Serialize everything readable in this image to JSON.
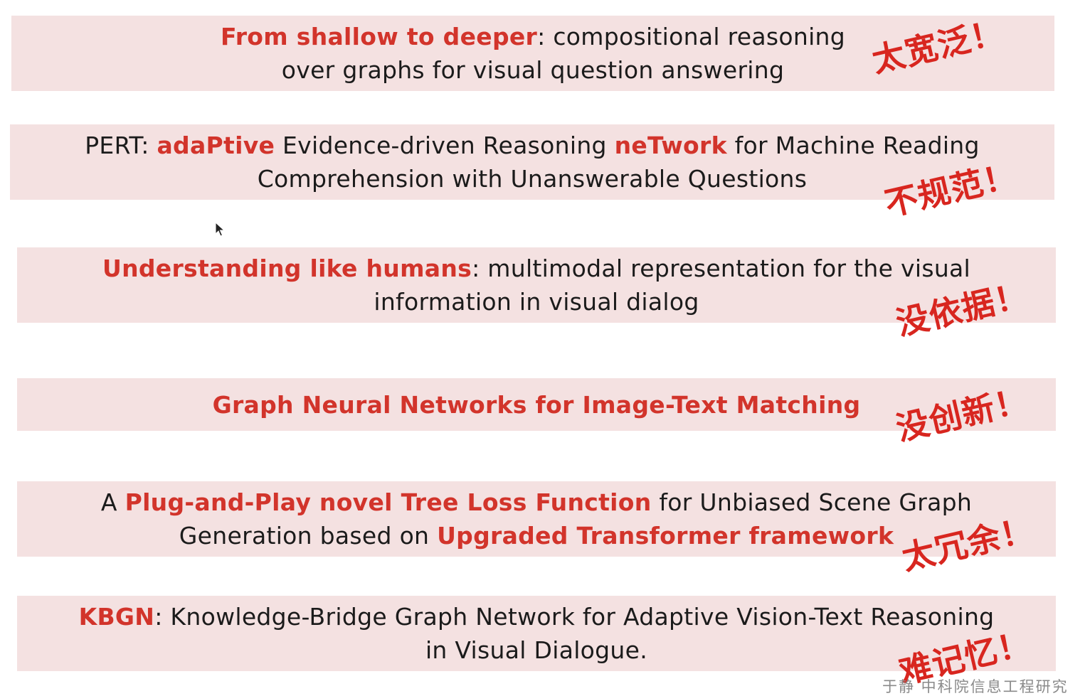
{
  "titles": [
    {
      "line1": [
        {
          "text": "From shallow to deeper",
          "hl": true
        },
        {
          "text": ": compositional reasoning",
          "hl": false
        }
      ],
      "line2": [
        {
          "text": "over graphs for visual question answering",
          "hl": false
        }
      ],
      "comment": "太宽泛！"
    },
    {
      "line1": [
        {
          "text": "PERT: ",
          "hl": false
        },
        {
          "text": "adaPtive",
          "hl": true
        },
        {
          "text": " Evidence-driven Reasoning ",
          "hl": false
        },
        {
          "text": "neTwork",
          "hl": true
        },
        {
          "text": " for Machine Reading",
          "hl": false
        }
      ],
      "line2": [
        {
          "text": "Comprehension with Unanswerable Questions",
          "hl": false
        }
      ],
      "comment": "不规范！"
    },
    {
      "line1": [
        {
          "text": "Understanding like humans",
          "hl": true
        },
        {
          "text": ":  multimodal representation for the visual",
          "hl": false
        }
      ],
      "line2": [
        {
          "text": "information in visual dialog",
          "hl": false
        }
      ],
      "comment": "没依据！"
    },
    {
      "line1": [
        {
          "text": "Graph Neural Networks for Image-Text Matching",
          "hl": true
        }
      ],
      "line2": [],
      "comment": "没创新！"
    },
    {
      "line1": [
        {
          "text": "A ",
          "hl": false
        },
        {
          "text": "Plug-and-Play novel Tree Loss Function",
          "hl": true
        },
        {
          "text": " for Unbiased Scene Graph",
          "hl": false
        }
      ],
      "line2": [
        {
          "text": "Generation based on ",
          "hl": false
        },
        {
          "text": "Upgraded Transformer framework",
          "hl": true
        }
      ],
      "comment": "太冗余！"
    },
    {
      "line1": [
        {
          "text": "KBGN",
          "hl": true
        },
        {
          "text": ": Knowledge-Bridge Graph Network for Adaptive Vision-Text Reasoning",
          "hl": false
        }
      ],
      "line2": [
        {
          "text": "in Visual Dialogue.",
          "hl": false
        }
      ],
      "comment": "难记忆！"
    }
  ],
  "watermark": "于静 中科院信息工程研究",
  "colors": {
    "band": "#f4e1e1",
    "highlight": "#d2342b",
    "comment": "#d8261f",
    "text": "#1b1b1b"
  },
  "icons": {
    "cursor": "mouse-pointer-icon"
  }
}
